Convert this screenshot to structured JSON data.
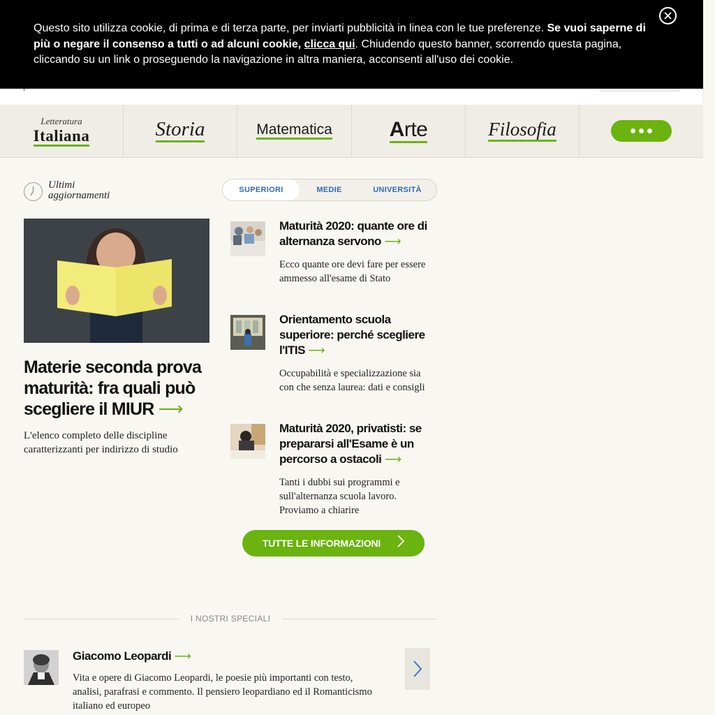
{
  "cookie": {
    "text_1": "Questo sito utilizza cookie, di prima e di terza parte, per inviarti pubblicità in linea con le tue preferenze. ",
    "text_bold": "Se vuoi saperne di più o negare il consenso a tutti o ad alcuni cookie, ",
    "link": "clicca qui",
    "text_2": ". Chiudendo questo banner, scorrendo questa pagina, cliccando su un link o proseguendo la navigazione in altra maniera, acconsenti all'uso dei cookie."
  },
  "subjects": {
    "lett_small": "Letteratura",
    "lett": "Italiana",
    "storia": "Storia",
    "matematica": "Matematica",
    "arte_a": "A",
    "arte_rest": "rte",
    "filosofia": "Filosofia"
  },
  "latest": {
    "label": "Ultimi aggiornamenti",
    "tabs": [
      "SUPERIORI",
      "MEDIE",
      "UNIVERSITÀ"
    ]
  },
  "main_article": {
    "title": "Materie seconda prova maturità: fra quali può scegliere il MIUR",
    "desc": "L'elenco completo delle discipline caratterizzanti per indirizzo di studio"
  },
  "articles": [
    {
      "title": "Maturità 2020: quante ore di alternanza servono",
      "desc": "Ecco quante ore devi fare per essere ammesso all'esame di Stato"
    },
    {
      "title": "Orientamento scuola superiore: perché scegliere l'ITIS",
      "desc": "Occupabilità e specializzazione sia con che senza laurea: dati e consigli"
    },
    {
      "title": "Maturità 2020, privatisti: se prepararsi all'Esame è un percorso a ostacoli",
      "desc": "Tanti i dubbi sui programmi e sull'alternanza scuola lavoro. Proviamo a chiarire"
    }
  ],
  "cta": {
    "label": "TUTTE LE INFORMAZIONI"
  },
  "specials": {
    "heading": "I NOSTRI SPECIALI",
    "item": {
      "title": "Giacomo Leopardi",
      "desc": "Vita e opere di Giacomo Leopardi, le poesie più importanti con testo, analisi, parafrasi e commento. Il pensiero leopardiano ed il Romanticismo italiano ed europeo"
    }
  },
  "arrow_glyph": "⟶",
  "colors": {
    "accent": "#6bb30f",
    "link_blue": "#2e6bb5",
    "banner_bg": "#000000"
  },
  "icons": [
    "close-icon",
    "clock-icon",
    "more-dots-icon",
    "chevron-right-icon"
  ]
}
